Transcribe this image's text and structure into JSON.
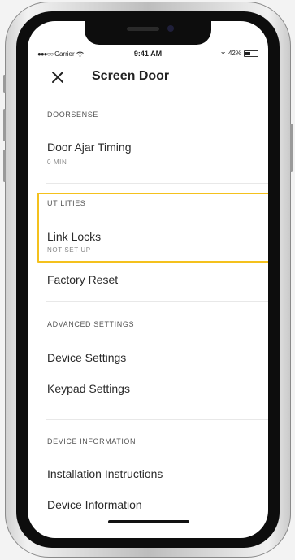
{
  "status_bar": {
    "carrier": "Carrier",
    "time": "9:41 AM",
    "battery": "42%",
    "battery_level": 0.42
  },
  "header": {
    "title": "Screen Door",
    "close_icon": "close-icon"
  },
  "sections": {
    "doorsense": {
      "label": "DOORSENSE",
      "items": [
        {
          "title": "Door Ajar Timing",
          "subtitle": "0 MIN"
        }
      ]
    },
    "utilities": {
      "label": "UTILITIES",
      "items": [
        {
          "title": "Link Locks",
          "subtitle": "NOT SET UP"
        },
        {
          "title": "Factory Reset"
        }
      ]
    },
    "advanced": {
      "label": "ADVANCED SETTINGS",
      "items": [
        {
          "title": "Device Settings"
        },
        {
          "title": "Keypad Settings"
        }
      ]
    },
    "device_info": {
      "label": "DEVICE INFORMATION",
      "items": [
        {
          "title": "Installation Instructions"
        },
        {
          "title": "Device Information"
        }
      ]
    }
  },
  "colors": {
    "highlight": "#f4c11d",
    "text": "#2a2a2a",
    "muted": "#888888"
  }
}
